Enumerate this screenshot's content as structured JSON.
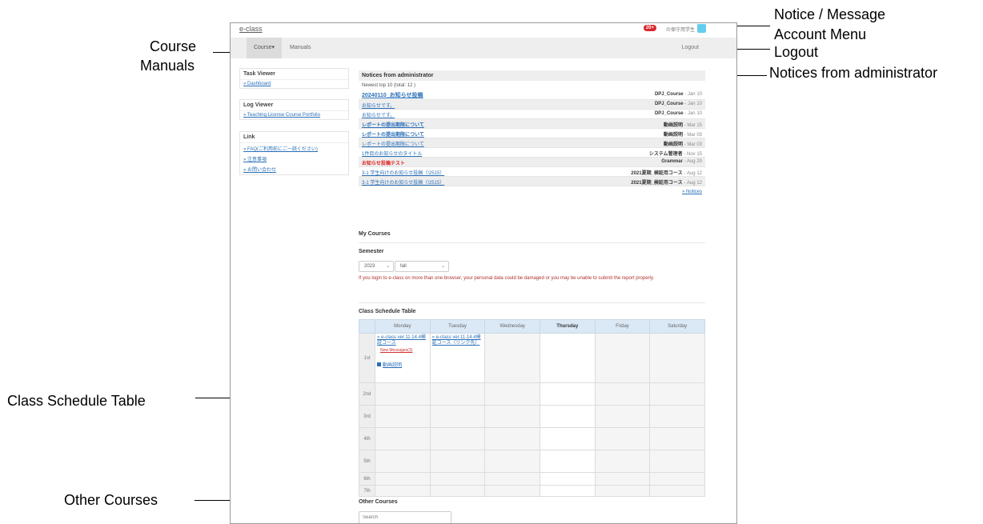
{
  "annotations": {
    "notice_message": "Notice / Message",
    "account_menu": "Account Menu",
    "logout": "Logout",
    "notices_admin": "Notices from administrator",
    "course": "Course",
    "manuals": "Manuals",
    "class_schedule": "Class Schedule Table",
    "other_courses": "Other  Courses"
  },
  "header": {
    "brand": "e-class",
    "badge": "20+",
    "account": "の保守用学生",
    "course_menu": "Course▾",
    "manuals": "Manuals",
    "logout": "Logout"
  },
  "sidebar": {
    "task_viewer": {
      "title": "Task Viewer",
      "links": [
        "» Dashboard"
      ]
    },
    "log_viewer": {
      "title": "Log Viewer",
      "links": [
        "» Teaching License Course Portfolio"
      ]
    },
    "link": {
      "title": "Link",
      "links": [
        "» FAQ(ご利用前にご一読ください)",
        "» 注意事項",
        "» お問い合わせ"
      ]
    }
  },
  "notices": {
    "title": "Notices from administrator",
    "count": "Newest top 10 (total: 12 )",
    "items": [
      {
        "title": "20240110_お知らせ投稿",
        "course": "DPJ_Course",
        "date": " - Jan 10"
      },
      {
        "title": "お知らせです。",
        "course": "DPJ_Course",
        "date": " - Jan 10"
      },
      {
        "title": "お知らせです。",
        "course": "DPJ_Course",
        "date": " - Jan 10"
      },
      {
        "title": "レポートの提出期限について",
        "course": "動画説明",
        "date": " - Mar 15"
      },
      {
        "title": "レポートの提出期限について",
        "course": "動画説明",
        "date": " - Mar 03"
      },
      {
        "title": "レポートの提出期限について",
        "course": "動画説明",
        "date": " - Mar 03"
      },
      {
        "title": "1件目のお知らせのタイトル",
        "course": "システム管理者",
        "date": " - Nov 15"
      },
      {
        "title": "お知らせ投稿テスト",
        "course": "Grammar",
        "date": " - Aug 20"
      },
      {
        "title": "3-1 学生向けのお知らせ投稿（!2515）",
        "course": "2021夏期_検証用コース",
        "date": " - Aug 12"
      },
      {
        "title": "3-1 学生向けのお知らせ投稿（!2515）",
        "course": "2021夏期_検証用コース",
        "date": " - Aug 12"
      }
    ],
    "more": "» Notices"
  },
  "my_courses": {
    "title": "My Courses",
    "semester_label": "Semester",
    "year": "2023",
    "term": "fall",
    "warning": "If you login to e-class on more than one browser, your personal data could be damaged or you may be unable to submit the report properly."
  },
  "schedule": {
    "title": "Class Schedule Table",
    "days": [
      "Monday",
      "Tuesday",
      "Wednesday",
      "Thursday",
      "Friday",
      "Saturday"
    ],
    "periods": [
      "1st",
      "2nd",
      "3rd",
      "4th",
      "5th",
      "6th",
      "7th"
    ],
    "mon_course": "» e-class ver.11.14.4検証コース",
    "mon_new": "New Messages(3)",
    "mon_doc": "動画説明",
    "tue_course": "» e-class ver.11.14.4検証コース（リンク先）"
  },
  "other_courses": {
    "title": "Other Courses",
    "search_placeholder": "Search"
  }
}
